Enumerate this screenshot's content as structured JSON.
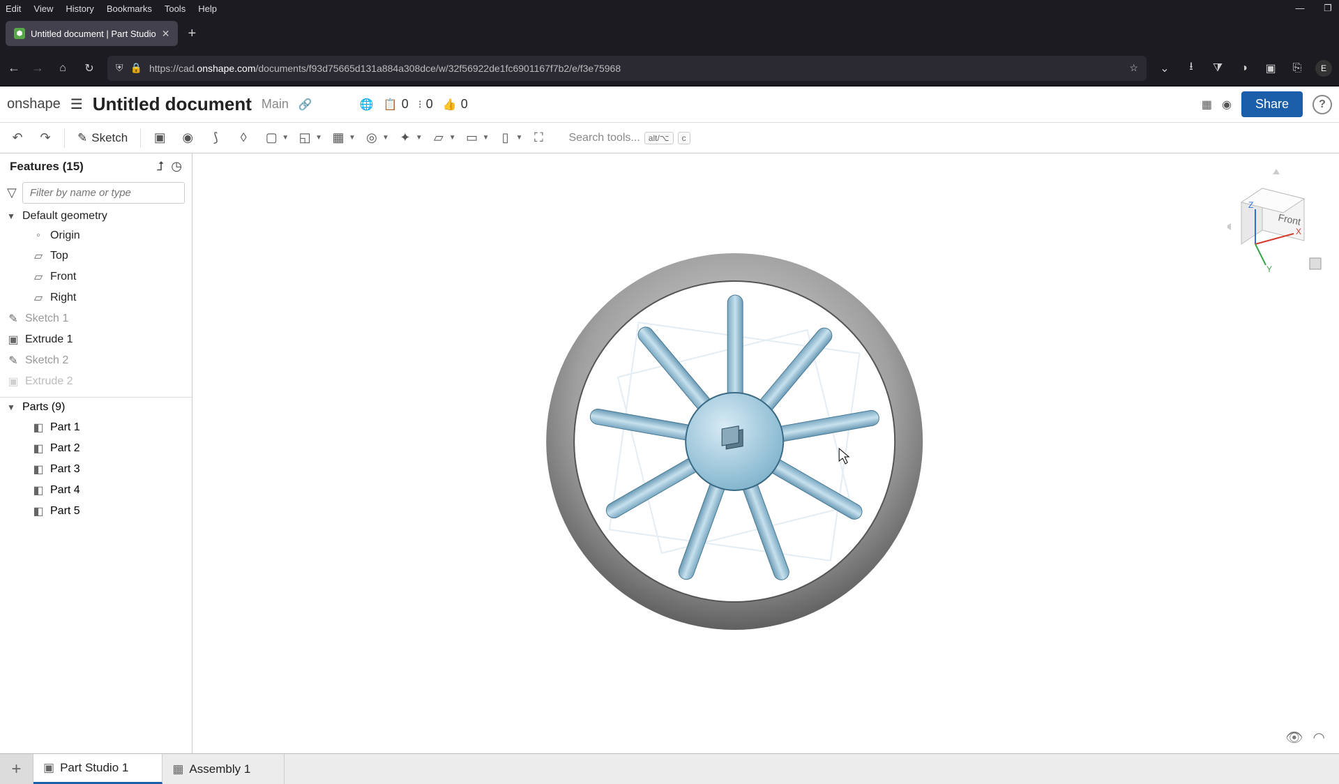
{
  "browser": {
    "menus": [
      "Edit",
      "View",
      "History",
      "Bookmarks",
      "Tools",
      "Help"
    ],
    "tab_title": "Untitled document | Part Studio",
    "url_prefix": "https://cad.",
    "url_domain": "onshape.com",
    "url_path": "/documents/f93d75665d131a884a308dce/w/32f56922de1fc6901167f7b2/e/f3e75968",
    "avatar_letter": "E"
  },
  "app": {
    "logo": "onshape",
    "doc_title": "Untitled document",
    "branch": "Main",
    "counts": {
      "copies": "0",
      "versions": "0",
      "likes": "0"
    },
    "share_label": "Share"
  },
  "toolbar": {
    "sketch_label": "Sketch",
    "search_placeholder": "Search tools...",
    "search_kbd1": "alt/⌥",
    "search_kbd2": "c"
  },
  "features": {
    "header": "Features (15)",
    "filter_placeholder": "Filter by name or type",
    "default_geometry": "Default geometry",
    "items_geo": [
      "Origin",
      "Top",
      "Front",
      "Right"
    ],
    "items_ops": [
      {
        "label": "Sketch 1",
        "muted": true,
        "icon": "pencil"
      },
      {
        "label": "Extrude 1",
        "muted": false,
        "icon": "extrude"
      },
      {
        "label": "Sketch 2",
        "muted": true,
        "icon": "pencil"
      },
      {
        "label": "Extrude 2",
        "muted": false,
        "icon": "extrude"
      }
    ]
  },
  "parts": {
    "header": "Parts (9)",
    "items": [
      "Part 1",
      "Part 2",
      "Part 3",
      "Part 4",
      "Part 5"
    ]
  },
  "viewcube": {
    "face": "Front",
    "axes": {
      "x": "X",
      "y": "Y",
      "z": "Z"
    }
  },
  "tabs": {
    "studio": "Part Studio 1",
    "assembly": "Assembly 1"
  }
}
